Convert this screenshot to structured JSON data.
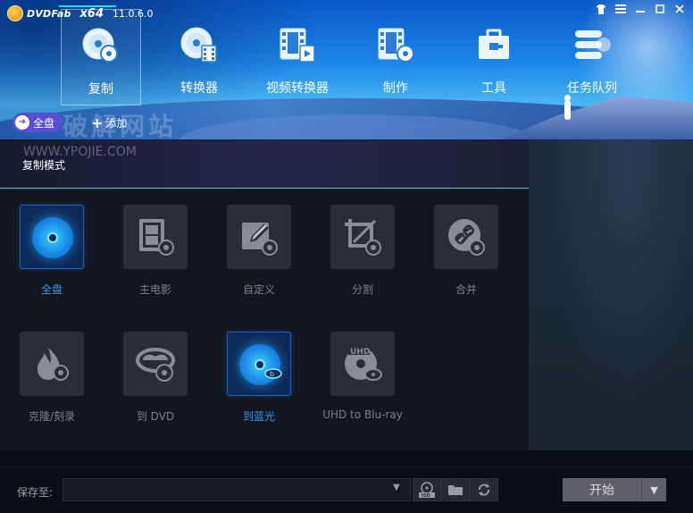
{
  "app": {
    "logo_text": "DVDFab",
    "arch": "x64",
    "version": "11.0.6.0"
  },
  "window_controls": [
    {
      "name": "skin-icon",
      "glyph": "👕"
    },
    {
      "name": "menu-icon",
      "glyph": "≡"
    },
    {
      "name": "minimize-icon",
      "glyph": "—"
    },
    {
      "name": "maximize-icon",
      "glyph": "□"
    },
    {
      "name": "close-icon",
      "glyph": "✕"
    }
  ],
  "nav": [
    {
      "id": "copy",
      "label": "复制",
      "icon": "disc-copy-icon",
      "active": true
    },
    {
      "id": "ripper",
      "label": "转换器",
      "icon": "disc-film-icon",
      "active": false
    },
    {
      "id": "video-converter",
      "label": "视频转换器",
      "icon": "film-converter-icon",
      "active": false
    },
    {
      "id": "creator",
      "label": "制作",
      "icon": "film-disc-icon",
      "active": false
    },
    {
      "id": "tools",
      "label": "工具",
      "icon": "toolbox-icon",
      "active": false
    },
    {
      "id": "queue",
      "label": "任务队列",
      "icon": "task-queue-icon",
      "active": false
    }
  ],
  "toolbar": {
    "full_disc_label": "全盘",
    "add_label": "添加"
  },
  "watermark": {
    "line1": "破解网站",
    "line2": "WWW.YPOJIE.COM"
  },
  "copy_mode": {
    "title": "复制模式",
    "modes": [
      {
        "label": "全盘",
        "icon": "full-disc-icon",
        "selected": true
      },
      {
        "label": "主电影",
        "icon": "main-movie-icon",
        "selected": false
      },
      {
        "label": "自定义",
        "icon": "customize-icon",
        "selected": false
      },
      {
        "label": "分割",
        "icon": "split-icon",
        "selected": false
      },
      {
        "label": "合并",
        "icon": "merge-icon",
        "selected": false
      },
      {
        "label": "克隆/刻录",
        "icon": "clone-burn-icon",
        "selected": false
      },
      {
        "label": "到 DVD",
        "icon": "to-dvd-icon",
        "selected": false
      },
      {
        "label": "到蓝光",
        "icon": "to-bluray-icon",
        "selected": true
      },
      {
        "label": "UHD to Blu-ray",
        "icon": "uhd-to-bluray-icon",
        "selected": false
      }
    ]
  },
  "footer": {
    "save_to_label": "保存至:",
    "save_path": "",
    "iso_icon": "iso-icon",
    "folder_icon": "folder-icon",
    "refresh_icon": "refresh-icon",
    "start_label": "开始"
  }
}
